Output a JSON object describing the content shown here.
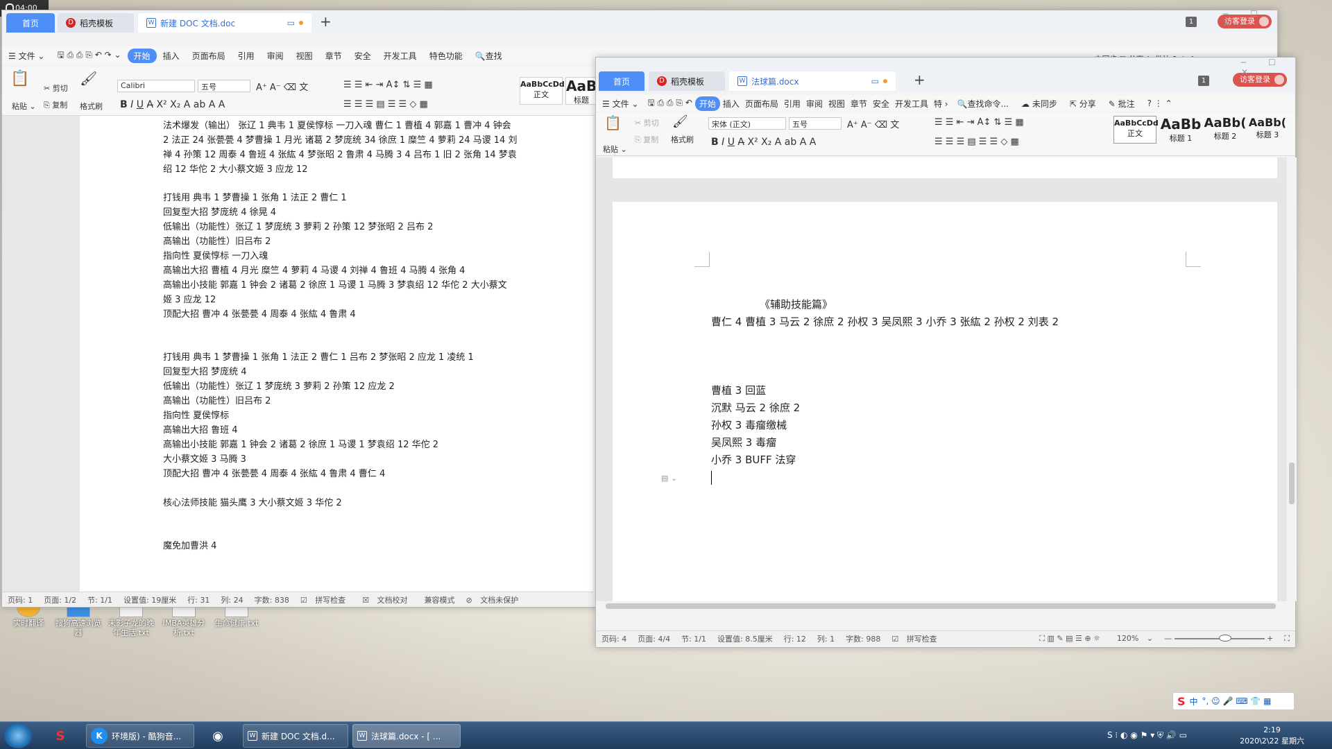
{
  "recorder": {
    "time": "04:00"
  },
  "desktop": {
    "icons": [
      "实时翻译",
      "搜狗高速浏览器",
      "末影子龙的晚年生活.txt",
      "IMBA英雄分析.txt",
      "生命健康.txt"
    ]
  },
  "win1": {
    "tabs": [
      "首页",
      "稻壳模板",
      "新建 DOC 文档.doc"
    ],
    "badge": "1",
    "visit": "访客登录",
    "menu": [
      "文件",
      "开始",
      "插入",
      "页面布局",
      "引用",
      "审阅",
      "视图",
      "章节",
      "安全",
      "开发工具",
      "特色功能",
      "查找"
    ],
    "sync": "未同步",
    "share": "分享",
    "annotate": "批注",
    "ribbon": {
      "paste": "粘贴",
      "cut": "剪切",
      "copy": "复制",
      "painter": "格式刷",
      "font": "Calibri",
      "size": "五号",
      "styles": [
        {
          "sample": "AaBbCcDd",
          "label": "正文"
        },
        {
          "sample": "AaB",
          "label": "标题"
        }
      ]
    },
    "lines": [
      "法术爆发（输出） 张辽 1 典韦 1 夏侯惇标 一刀入魂  曹仁 1 曹植 4 郭嘉 1 曹冲 4 钟会",
      "2  法正 24 张甍甍 4 梦曹操 1 月光 诸葛 2 梦庞统 34  徐庶 1 糜竺 4 萝莉 24 马谡 14 刘",
      "禅 4 孙策 12 周泰 4 鲁班 4  张紘 4 梦张昭 2 鲁肃 4  马腾 3 4 吕布 1 旧 2 张角 14 梦袁",
      "绍 12  华佗 2 大小蔡文姬 3 应龙 12",
      "打钱用   典韦 1 梦曹操 1  张角 1 法正 2 曹仁 1",
      "回复型大招 梦庞统 4 徐晃 4",
      "低输出（功能性）张辽 1 梦庞统 3 萝莉 2 孙策 12 梦张昭 2 吕布 2",
      "高输出（功能性）旧吕布 2",
      "指向性 夏侯惇标 一刀入魂",
      "高输出大招  曹植 4  月光  糜竺 4 萝莉 4 马谡 4 刘禅 4 鲁班 4 马腾 4 张角 4",
      "高输出小技能  郭嘉 1 钟会 2 诸葛 2 徐庶 1 马谡 1  马腾 3 梦袁绍 12 华佗 2 大小蔡文",
      "姬 3 应龙 12",
      "顶配大招 曹冲 4 张甍甍 4 周泰 4 张紘 4 鲁肃 4",
      "打钱用   典韦 1 梦曹操 1  张角 1 法正 2 曹仁 1  吕布 2 梦张昭 2 应龙 1 凌统 1",
      "回复型大招 梦庞统 4",
      "低输出（功能性）张辽 1 梦庞统 3 萝莉 2 孙策 12  应龙 2",
      "高输出（功能性）旧吕布 2",
      "指向性 夏侯惇标",
      "高输出大招    鲁班 4",
      "高输出小技能  郭嘉 1 钟会 2 诸葛 2 徐庶 1 马谡 1   梦袁绍 12 华佗 2",
      "大小蔡文姬 3 马腾 3",
      "顶配大招 曹冲 4 张甍甍 4 周泰 4 张紘 4 鲁肃 4 曹仁 4",
      "核心法师技能 猫头鹰 3 大小蔡文姬 3 华佗 2",
      "魔免加曹洪 4"
    ],
    "status": [
      "页码: 1",
      "页面: 1/2",
      "节: 1/1",
      "设置值: 19厘米",
      "行: 31",
      "列: 24",
      "字数: 838",
      "拼写检查",
      "文档校对",
      "兼容模式",
      "文档未保护"
    ]
  },
  "win2": {
    "tabs": [
      "首页",
      "稻壳模板",
      "法球篇.docx"
    ],
    "badge": "1",
    "visit": "访客登录",
    "menu": [
      "文件",
      "开始",
      "插入",
      "页面布局",
      "引用",
      "审阅",
      "视图",
      "章节",
      "安全",
      "开发工具",
      "特",
      "查找命令..."
    ],
    "sync": "未同步",
    "share": "分享",
    "annotate": "批注",
    "ribbon": {
      "paste": "粘贴",
      "cut": "剪切",
      "copy": "复制",
      "painter": "格式刷",
      "font": "宋体 (正文)",
      "size": "五号",
      "styles": [
        {
          "sample": "AaBbCcDd",
          "label": "正文"
        },
        {
          "sample": "AaBb",
          "label": "标题 1"
        },
        {
          "sample": "AaBb(",
          "label": "标题 2"
        },
        {
          "sample": "AaBb(",
          "label": "标题 3"
        }
      ]
    },
    "lines": [
      "《辅助技能篇》",
      "曹仁 4 曹植 3 马云 2 徐庶 2 孙权 3 吴凤熙 3 小乔 3 张紘 2 孙权 2 刘表 2",
      "曹植 3  回蓝",
      "沉默  马云 2 徐庶 2",
      "孙权 3   毒瘤缴械",
      "吴凤熙 3 毒瘤",
      "小乔 3 BUFF 法穿"
    ],
    "status": [
      "页码: 4",
      "页面: 4/4",
      "节: 1/1",
      "设置值: 8.5厘米",
      "行: 12",
      "列: 1",
      "字数: 988",
      "拼写检查"
    ],
    "zoom": "120%"
  },
  "ime": {
    "mode": "中"
  },
  "taskbar": {
    "items": [
      "环境版) - 酷狗音...",
      "新建 DOC 文档.d...",
      "法球篇.docx - [ ..."
    ],
    "time": "2:19",
    "date": "2020\\2\\22 星期六"
  }
}
